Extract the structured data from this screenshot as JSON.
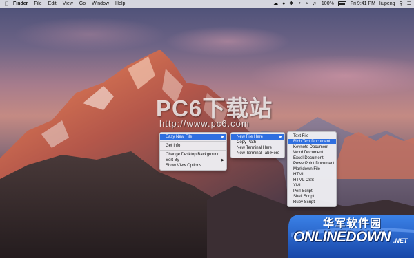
{
  "menubar": {
    "apple_icon": "apple-logo-icon",
    "items": [
      "Finder",
      "File",
      "Edit",
      "View",
      "Go",
      "Window",
      "Help"
    ],
    "battery_percent": "100%",
    "clock": "Fri 9:41 PM",
    "user": "liupeng"
  },
  "watermark": {
    "title": "PC6下载站",
    "url": "http://www.pc6.com"
  },
  "context_menu": {
    "items": [
      {
        "label": "Easy New File",
        "has_submenu": true,
        "selected": true
      },
      {
        "label": "Get Info"
      },
      {
        "label": "Change Desktop Background..."
      },
      {
        "label": "Sort By",
        "has_submenu": true
      },
      {
        "label": "Show View Options"
      }
    ]
  },
  "submenu_easy_new_file": {
    "items": [
      {
        "label": "New File Here",
        "has_submenu": true,
        "selected": true
      },
      {
        "label": "Copy Path"
      },
      {
        "label": "New Terminal Here"
      },
      {
        "label": "New Terminal Tab Here"
      }
    ]
  },
  "submenu_new_file_here": {
    "items": [
      {
        "label": "Text File"
      },
      {
        "label": "Rich Text Document",
        "selected": true
      },
      {
        "label": "Keynote Document"
      },
      {
        "label": "Word Document"
      },
      {
        "label": "Excel Document"
      },
      {
        "label": "PowerPoint Document"
      },
      {
        "label": "Markdown File"
      },
      {
        "label": "HTML"
      },
      {
        "label": "HTML CSS"
      },
      {
        "label": "XML"
      },
      {
        "label": "Perl Script"
      },
      {
        "label": "Shell Script"
      },
      {
        "label": "Ruby Script"
      }
    ]
  },
  "logo": {
    "cn_text": "华军软件园",
    "en_text": "ONLINEDOWN",
    "suffix": ".NET"
  },
  "colors": {
    "selection": "#2f6fe0",
    "logo_blue": "#1f5fcf"
  }
}
